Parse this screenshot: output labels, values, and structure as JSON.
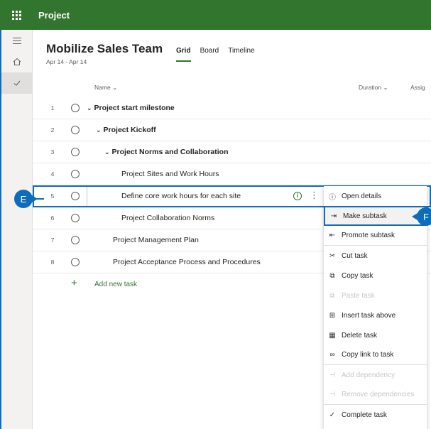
{
  "app": {
    "name": "Project"
  },
  "plan": {
    "title": "Mobilize Sales Team",
    "dates": "Apr 14 - Apr 14"
  },
  "views": {
    "grid": "Grid",
    "board": "Board",
    "timeline": "Timeline"
  },
  "columns": {
    "name": "Name",
    "duration": "Duration",
    "assigned": "Assig"
  },
  "tasks": [
    {
      "num": "1",
      "name": "Project start milestone"
    },
    {
      "num": "2",
      "name": "Project Kickoff"
    },
    {
      "num": "3",
      "name": "Project Norms and Collaboration"
    },
    {
      "num": "4",
      "name": "Project Sites and Work Hours"
    },
    {
      "num": "5",
      "name": "Define core work hours for each site"
    },
    {
      "num": "6",
      "name": "Project Collaboration Norms"
    },
    {
      "num": "7",
      "name": "Project Management Plan"
    },
    {
      "num": "8",
      "name": "Project Acceptance Process and Procedures"
    }
  ],
  "add_task": "Add new task",
  "menu": {
    "open_details": "Open details",
    "make_subtask": "Make subtask",
    "promote_subtask": "Promote subtask",
    "cut_task": "Cut task",
    "copy_task": "Copy task",
    "paste_task": "Paste task",
    "insert_task_above": "Insert task above",
    "delete_task": "Delete task",
    "copy_link": "Copy link to task",
    "add_dependency": "Add dependency",
    "remove_dependencies": "Remove dependencies",
    "complete_task": "Complete task"
  },
  "callouts": {
    "e": "E",
    "f": "F"
  },
  "colors": {
    "brand": "#31752f",
    "accent": "#0f6cbd"
  },
  "icons": [
    "waffle-icon",
    "hamburger-icon",
    "home-icon",
    "check-icon",
    "chevron-down-icon",
    "info-icon",
    "more-icon",
    "plus-icon",
    "scissors-icon",
    "copy-icon",
    "paste-icon",
    "insert-icon",
    "trash-icon",
    "link-icon",
    "dependency-icon",
    "complete-icon"
  ]
}
